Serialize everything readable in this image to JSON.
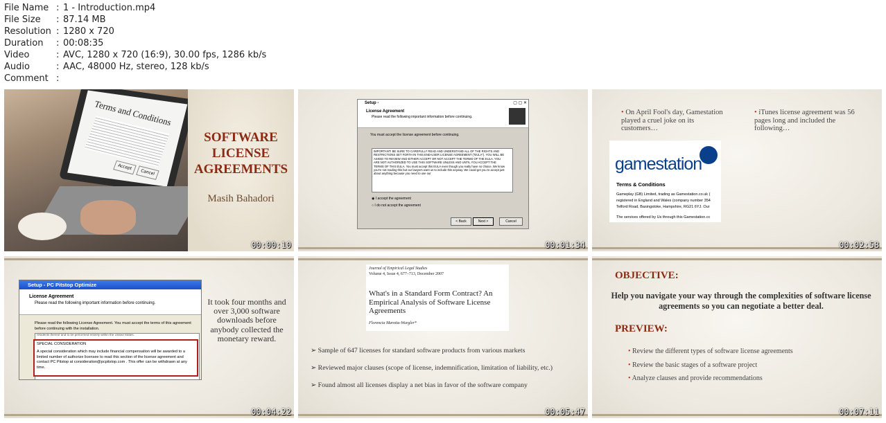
{
  "file_info": [
    {
      "key": "File Name",
      "value": "1 - Introduction.mp4"
    },
    {
      "key": "File Size",
      "value": "87.14 MB"
    },
    {
      "key": "Resolution",
      "value": "1280 x 720"
    },
    {
      "key": "Duration",
      "value": "00:08:35"
    },
    {
      "key": "Video",
      "value": "AVC, 1280 x 720 (16:9), 30.00 fps, 1286 kb/s"
    },
    {
      "key": "Audio",
      "value": "AAC, 48000 Hz, stereo, 128 kb/s"
    },
    {
      "key": "Comment",
      "value": ""
    }
  ],
  "thumbs": [
    {
      "timestamp": "00:00:10",
      "laptop_screen_text": "Terms and Conditions",
      "accept_btn": "Accept",
      "cancel_btn": "Cancel",
      "title_lines": [
        "SOFTWARE",
        "LICENSE",
        "AGREEMENTS"
      ],
      "author": "Masih Bahadori"
    },
    {
      "timestamp": "00:01:34",
      "window_title": "Setup -",
      "heading": "License Agreement",
      "subheading": "Please read the following important information before continuing.",
      "must_accept": "You must accept the license agreement before continuing.",
      "eula_text": "IMPORTANT! BE SURE TO CAREFULLY READ AND UNDERSTAND ALL OF THE RIGHTS AND RESTRICTIONS SET FORTH IN THIS END-USER LICENSE AGREEMENT (\"EULA\"). YOU WILL BE ASKED TO REVIEW AND EITHER ACCEPT OR NOT ACCEPT THE TERMS OF THE EULA. YOU ARE NOT AUTHORIZED TO USE THIS SOFTWARE UNLESS AND UNTIL YOU ACCEPT THE TERMS OF THIS EULA. You must accept this EULA even though you really have no choice. We know you're not reading this but our lawyers want us to include this anyway. We could get you to accept just about anything because you need to use our",
      "radio_accept": "I accept the agreement",
      "radio_decline": "I do not accept the agreement",
      "btn_back": "< Back",
      "btn_next": "Next >",
      "btn_cancel": "Cancel"
    },
    {
      "timestamp": "00:02:58",
      "bullet_left": "On April Fool's day, Gamestation played a cruel joke on its customers…",
      "bullet_right": "iTunes license agreement was 56 pages long and included the following…",
      "logo": "gamestation",
      "tc_heading": "Terms & Conditions",
      "tc_text1": "Gameplay (GB) Limited, trading as Gamestation.co.uk (",
      "tc_text2": "registered in England and Wales (company number 354",
      "tc_text3": "Telford Road, Basingstoke, Hampshire, RG21 6YJ. Our",
      "tc_text4": "The services offered by Us through this Gamestation.cc"
    },
    {
      "timestamp": "00:04:22",
      "window_title": "Setup - PC Pitstop Optimize",
      "heading": "License Agreement",
      "subheading": "Please read the following important information before continuing.",
      "instruction": "Please read the following License Agreement. You must accept the terms of this agreement before continuing with the installation.",
      "cut_text": "residents thereof and to be performed entirely within the United States.",
      "special_heading": "SPECIAL CONSIDERATION",
      "special_text": "A special consideration which may include financial compensation will be awarded to a limited number of authorize licensee to read this section of the license agreement and contact PC Pitstop at consideration@pcpitstop.com .   This offer can be withdrawn at any time.",
      "caption": "It took four months and over 3,000 software downloads before anybody collected the monetary reward."
    },
    {
      "timestamp": "00:05:47",
      "journal": "Journal of Empirical Legal Studies",
      "volume": "Volume 4, Issue 4, 677–713, December 2007",
      "paper_title": "What's in a Standard Form Contract? An Empirical Analysis of Software License Agreements",
      "author": "Florencia Marotta-Wurgler*",
      "bullets": [
        "Sample of 647 licenses for standard software products from various markets",
        "Reviewed major clauses (scope of license, indemnification, limitation of liability, etc.)",
        "Found almost all licenses display a net bias in favor of the software company"
      ]
    },
    {
      "timestamp": "00:07:11",
      "objective_heading": "OBJECTIVE:",
      "objective_text": "Help you navigate your way through the complexities of software license agreements so you can negotiate a better deal.",
      "preview_heading": "PREVIEW:",
      "preview_items": [
        "Review the different types of software license agreements",
        "Review the basic stages of a software project",
        "Analyze clauses and provide recommendations"
      ]
    }
  ],
  "colors": {
    "accent_brown": "#8b2a12",
    "bar": "#b7a58a",
    "gs_blue": "#0a3f8c",
    "xp_blue": "#2456d6"
  }
}
